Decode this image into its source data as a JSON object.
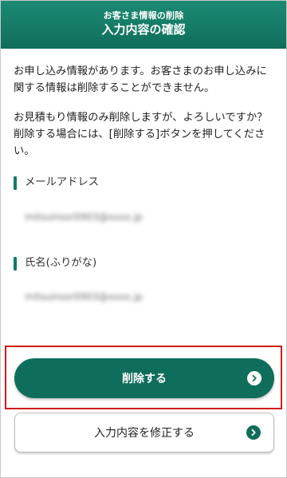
{
  "header": {
    "subtitle": "お客さま情報の削除",
    "title": "入力内容の確認"
  },
  "messages": {
    "paragraph1": "お申し込み情報があります。お客さまのお申し込みに関する情報は削除することができません。",
    "paragraph2": "お見積もり情報のみ削除しますが、よろしいですか？削除する場合には、[削除する]ボタンを押してください。"
  },
  "fields": {
    "email": {
      "label": "メールアドレス",
      "value": "mitsuinssr0903@xxxx.jp"
    },
    "name": {
      "label": "氏名(ふりがな)",
      "value": "mitsuinssr0903@xxxx.jp"
    }
  },
  "buttons": {
    "delete_label": "削除する",
    "edit_label": "入力内容を修正する"
  },
  "colors": {
    "brand": "#0f6e5b",
    "highlight": "#d11b1b"
  },
  "icons": {
    "button_arrow": "chevron-right-circle-icon"
  }
}
